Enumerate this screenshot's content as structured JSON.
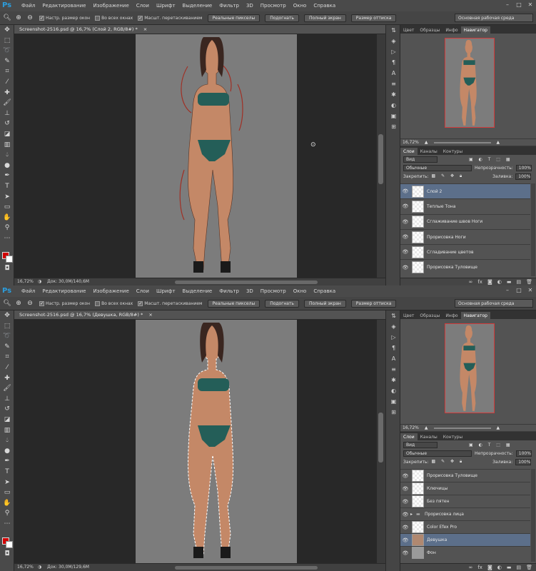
{
  "menus": [
    "Файл",
    "Редактирование",
    "Изображение",
    "Слои",
    "Шрифт",
    "Выделение",
    "Фильтр",
    "3D",
    "Просмотр",
    "Окно",
    "Справка"
  ],
  "app_logo": "Ps",
  "options": {
    "checks": [
      "Настр. размер окон",
      "Во всех окнах",
      "Масшт. перетаскиванием"
    ],
    "checked": [
      true,
      false,
      true
    ],
    "buttons": [
      "Реальные пикселы",
      "Подогнать",
      "Полный экран",
      "Размер оттиска"
    ],
    "workspace": "Основная рабочая среда"
  },
  "panel_tabs": {
    "top": [
      "Цвет",
      "Образцы",
      "Инфо",
      "Навигатор"
    ],
    "active_top": "Навигатор",
    "layers": [
      "Слои",
      "Каналы",
      "Контуры"
    ],
    "active_layers": "Слои"
  },
  "layer_controls": {
    "kind": "Вид",
    "blend": "Обычные",
    "opacity_label": "Непрозрачность:",
    "opacity": "100%",
    "lock_label": "Закрепить:",
    "fill_label": "Заливка:",
    "fill": "100%"
  },
  "top": {
    "doc_title": "Screenshot-2516.psd @ 16,7% (Слой 2, RGB/8#) *",
    "zoom": "16,72%",
    "doc_info": "Док: 30,0M/140,6M",
    "nav_zoom": "16,72%",
    "layers": [
      "Слой 2",
      "Теплые Тона",
      "Сглаживание швов Ноги",
      "Прорисовка Ноги",
      "Сгладивание цветов",
      "Прорисовка Туловище"
    ],
    "selected_layer": 0
  },
  "bottom": {
    "doc_title": "Screenshot-2516.psd @ 16,7% (Девушка, RGB/8#) *",
    "zoom": "16,72%",
    "doc_info": "Док: 30,0M/129,6M",
    "nav_zoom": "16,72%",
    "layers": [
      "Прорисовка Туловище",
      "Ключицы",
      "Без пятен",
      "Прорисовка лица",
      "Color Efex Pro",
      "Девушка",
      "Фон"
    ],
    "selected_layer": 5
  },
  "colors": {
    "foreground": "#d10000",
    "background": "#ffffff",
    "selected_layer": "#5c6f8a"
  }
}
